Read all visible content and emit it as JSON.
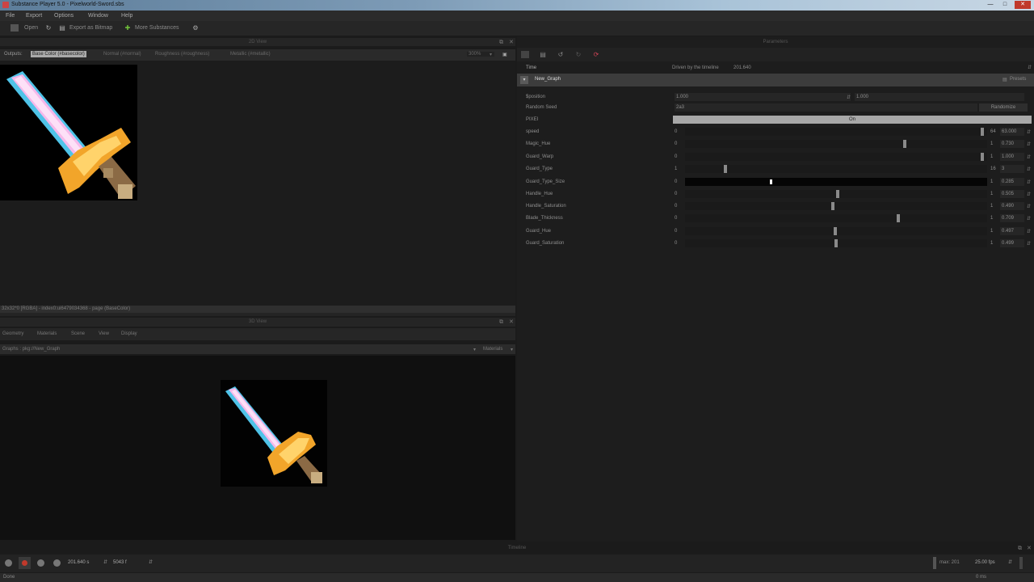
{
  "window": {
    "title": "Substance Player 5.0 - Pixelworld-Sword.sbs",
    "min": "—",
    "max": "□",
    "close": "✕"
  },
  "menu": [
    "File",
    "Export",
    "Options",
    "Window",
    "Help"
  ],
  "toolbar": {
    "open": "Open",
    "export": "Export as Bitmap",
    "more": "More Substances"
  },
  "view2d": {
    "title": "2D View",
    "outputs_label": "Outputs:",
    "outputs": [
      "Base Color (#basecolor)",
      "Normal (#normal)",
      "Roughness (#roughness)",
      "Metallic (#metallic)"
    ],
    "zoom": "300%",
    "status": "32x32*0 [RGBA] - index0:ui6479034368 - page (BaseColor)"
  },
  "view3d": {
    "title": "3D View",
    "menu": [
      "Geometry",
      "Materials",
      "Scene",
      "View",
      "Display"
    ],
    "graph": "Graphs : pkg://New_Graph",
    "materials": "Materials"
  },
  "params": {
    "title": "Parameters",
    "time_label": "Time",
    "time_value": "Driven by the timeline",
    "time_num": "201.640",
    "graph": "New_Graph",
    "presets": "Presets",
    "rows": [
      {
        "label": "$position",
        "type": "pair",
        "v1": "1.000",
        "v2": "1.000"
      },
      {
        "label": "Random Seed",
        "type": "seed",
        "v1": "2a3",
        "btn": "Randomize"
      },
      {
        "label": "PIXEI",
        "type": "toggle",
        "v1": "On"
      },
      {
        "label": "speed",
        "type": "slider",
        "min": "0",
        "max": "64",
        "val": "63.000",
        "frac": 0.99
      },
      {
        "label": "Magic_Hue",
        "type": "slider",
        "min": "0",
        "max": "1",
        "val": "0.730",
        "frac": 0.73
      },
      {
        "label": "Guard_Warp",
        "type": "slider",
        "min": "0",
        "max": "1",
        "val": "1.000",
        "frac": 0.99
      },
      {
        "label": "Guard_Type",
        "type": "slider",
        "min": "1",
        "max": "16",
        "val": "3",
        "frac": 0.13
      },
      {
        "label": "Guard_Type_Size",
        "type": "slider",
        "min": "0",
        "max": "1",
        "val": "0.285",
        "frac": 0.285,
        "active": true
      },
      {
        "label": "Handle_Hue",
        "type": "slider",
        "min": "0",
        "max": "1",
        "val": "0.505",
        "frac": 0.505
      },
      {
        "label": "Handle_Saturation",
        "type": "slider",
        "min": "0",
        "max": "1",
        "val": "0.490",
        "frac": 0.49
      },
      {
        "label": "Blade_Thickness",
        "type": "slider",
        "min": "0",
        "max": "1",
        "val": "0.709",
        "frac": 0.709
      },
      {
        "label": "Guard_Hue",
        "type": "slider",
        "min": "0",
        "max": "1",
        "val": "0.497",
        "frac": 0.497
      },
      {
        "label": "Guard_Saturation",
        "type": "slider",
        "min": "0",
        "max": "1",
        "val": "0.499",
        "frac": 0.499
      }
    ]
  },
  "timeline": {
    "title": "Timeline",
    "time": "201.640 s",
    "frame": "5043 f",
    "max": "max: 201",
    "fps": "25.00 fps",
    "unit": "0 ms"
  },
  "status": {
    "text": "Done"
  },
  "colors": {
    "accent": "#9a9a9a",
    "record": "#c0392b"
  }
}
